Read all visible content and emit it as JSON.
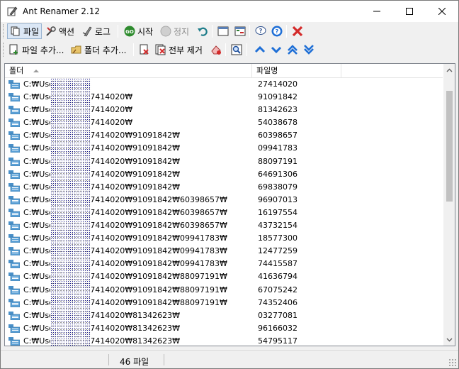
{
  "window": {
    "title": "Ant Renamer 2.12"
  },
  "toolbar1": {
    "file_label": "파일",
    "action_label": "액션",
    "log_label": "로그",
    "start_label": "시작",
    "stop_label": "정지"
  },
  "toolbar2": {
    "add_files_label": "파일 추가...",
    "add_folders_label": "폴더 추가...",
    "remove_all_label": "전부 제거"
  },
  "list": {
    "columns": {
      "folder": "폴더",
      "filename": "파일명"
    },
    "rows": [
      {
        "folder": "C:₩Use          sktop₩",
        "filename": "27414020"
      },
      {
        "folder": "C:₩Use          sktop₩27414020₩",
        "filename": "91091842"
      },
      {
        "folder": "C:₩Use          sktop₩27414020₩",
        "filename": "81342623"
      },
      {
        "folder": "C:₩Use          sktop₩27414020₩",
        "filename": "54038678"
      },
      {
        "folder": "C:₩Use          sktop₩27414020₩91091842₩",
        "filename": "60398657"
      },
      {
        "folder": "C:₩Use          sktop₩27414020₩91091842₩",
        "filename": "09941783"
      },
      {
        "folder": "C:₩Use          sktop₩27414020₩91091842₩",
        "filename": "88097191"
      },
      {
        "folder": "C:₩Use          sktop₩27414020₩91091842₩",
        "filename": "64691306"
      },
      {
        "folder": "C:₩Use          sktop₩27414020₩91091842₩",
        "filename": "69838079"
      },
      {
        "folder": "C:₩Use          sktop₩27414020₩91091842₩60398657₩",
        "filename": "96907013"
      },
      {
        "folder": "C:₩Use          sktop₩27414020₩91091842₩60398657₩",
        "filename": "16197554"
      },
      {
        "folder": "C:₩Use          sktop₩27414020₩91091842₩60398657₩",
        "filename": "43732154"
      },
      {
        "folder": "C:₩Use          sktop₩27414020₩91091842₩09941783₩",
        "filename": "18577300"
      },
      {
        "folder": "C:₩Use          sktop₩27414020₩91091842₩09941783₩",
        "filename": "12477259"
      },
      {
        "folder": "C:₩Use          sktop₩27414020₩91091842₩09941783₩",
        "filename": "74415587"
      },
      {
        "folder": "C:₩Use          sktop₩27414020₩91091842₩88097191₩",
        "filename": "41636794"
      },
      {
        "folder": "C:₩Use          sktop₩27414020₩91091842₩88097191₩",
        "filename": "67075242"
      },
      {
        "folder": "C:₩Use          sktop₩27414020₩91091842₩88097191₩",
        "filename": "74352406"
      },
      {
        "folder": "C:₩Use          sktop₩27414020₩81342623₩",
        "filename": "03277081"
      },
      {
        "folder": "C:₩Use          sktop₩27414020₩81342623₩",
        "filename": "96166032"
      },
      {
        "folder": "C:₩Use          sktop₩27414020₩81342623₩",
        "filename": "54795117"
      }
    ]
  },
  "status": {
    "file_count": "46 파일"
  },
  "colors": {
    "accent_blue": "#1f6fd6",
    "start_green": "#2e8b2e",
    "remove_red": "#d42a2a"
  }
}
